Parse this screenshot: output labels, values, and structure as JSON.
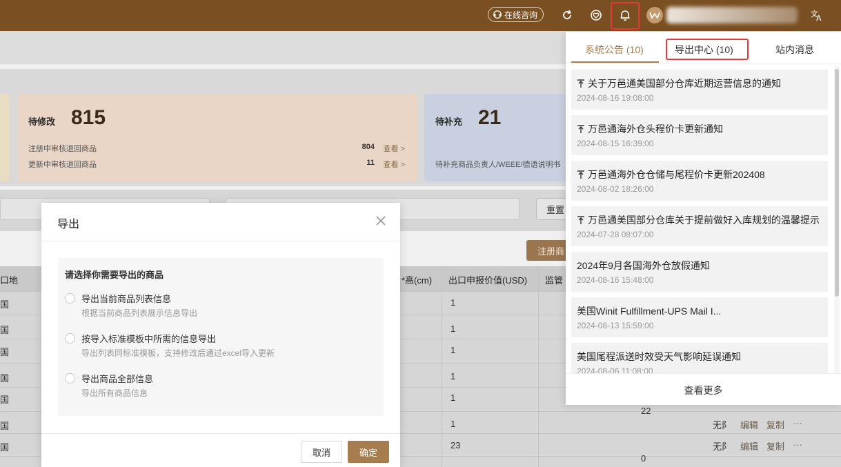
{
  "header": {
    "consult_label": "在线咨询",
    "icons": [
      "headset-icon",
      "refresh-icon",
      "heart-icon",
      "bell-icon",
      "translate-icon"
    ]
  },
  "cards": {
    "pending_edit": {
      "title": "待修改",
      "count": "815",
      "rows": [
        {
          "label": "注册中审核退回商品",
          "value": "804",
          "link": "查看 >"
        },
        {
          "label": "更新中审核退回商品",
          "value": "11",
          "link": "查看 >"
        }
      ]
    },
    "pending_supplement": {
      "title": "待补充",
      "count": "21",
      "row": "待补充商品负责人/WEEE/德语说明书"
    }
  },
  "filters": {
    "reset_label": "重置",
    "register_label": "注册商"
  },
  "table": {
    "headers": [
      "口地",
      "*高(cm)",
      "出口申报价值(USD)",
      "监管"
    ],
    "first_col": [
      "国",
      "国",
      "国",
      "国",
      "国",
      "国",
      "国"
    ],
    "values": [
      "1",
      "1",
      "1",
      "1",
      "1",
      "1",
      "23"
    ],
    "extra": {
      "val_22": "22",
      "val_0": "0",
      "nolimit": "无阝"
    },
    "actions": {
      "edit": "编辑",
      "copy": "复制",
      "more": "···"
    }
  },
  "dialog": {
    "title": "导出",
    "question": "请选择你需要导出的商品",
    "options": [
      {
        "label": "导出当前商品列表信息",
        "desc": "根据当前商品列表展示信息导出"
      },
      {
        "label": "按导入标准模板中所需的信息导出",
        "desc": "导出列表同标准模板，支持修改后通过excel导入更新"
      },
      {
        "label": "导出商品全部信息",
        "desc": "导出所有商品信息"
      }
    ],
    "cancel_label": "取消",
    "ok_label": "确定"
  },
  "panel": {
    "tabs": [
      "系统公告 (10)",
      "导出中心 (10)",
      "站内消息"
    ],
    "items": [
      {
        "pinned": true,
        "title": "关于万邑通美国部分仓库近期运营信息的通知",
        "date": "2024-08-16 19:08:00"
      },
      {
        "pinned": true,
        "title": "万邑通海外仓头程价卡更新通知",
        "date": "2024-08-15 16:39:00"
      },
      {
        "pinned": true,
        "title": "万邑通海外仓仓储与尾程价卡更新202408",
        "date": "2024-08-02 18:26:00"
      },
      {
        "pinned": true,
        "title": "万邑通美国部分仓库关于提前做好入库规划的温馨提示",
        "date": "2024-07-28 08:07:00"
      },
      {
        "pinned": false,
        "title": "2024年9月各国海外仓放假通知",
        "date": "2024-08-16 15:48:00"
      },
      {
        "pinned": false,
        "title": "美国Winit Fulfillment-UPS Mail I...",
        "date": "2024-08-13 15:59:00"
      },
      {
        "pinned": false,
        "title": "美国尾程派送时效受天气影响延误通知",
        "date": "2024-08-06 11:08:00"
      }
    ],
    "more_label": "查看更多"
  },
  "colors": {
    "topbar": "#7a4f22",
    "accent": "#a87c4f",
    "highlight": "#e53935"
  }
}
